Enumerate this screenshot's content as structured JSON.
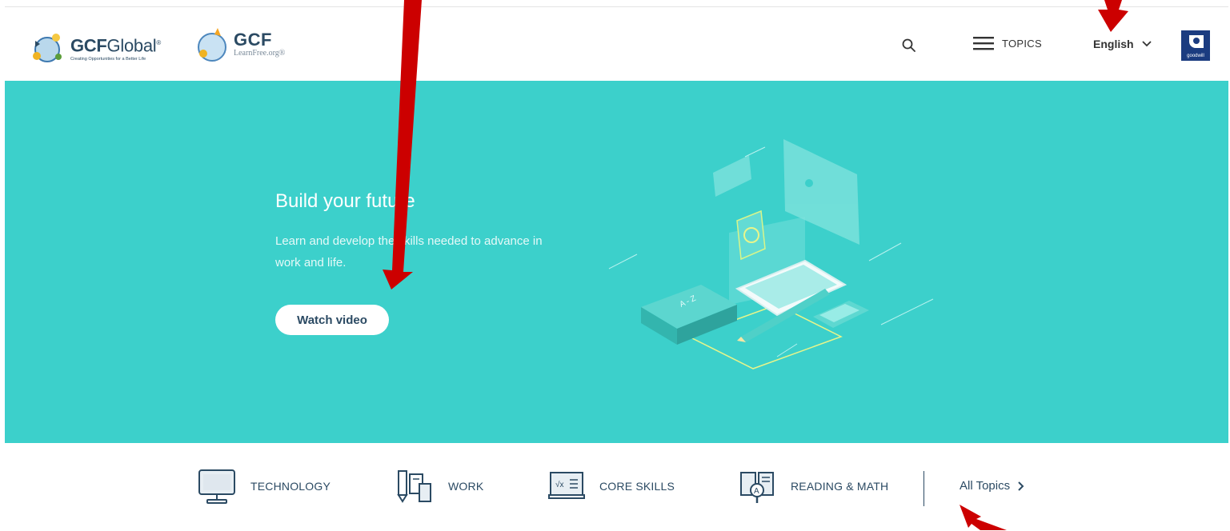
{
  "header": {
    "logo_primary_bold": "GCF",
    "logo_primary_rest": "Global",
    "logo_primary_mark": "®",
    "logo_primary_tagline": "Creating Opportunities for a Better Life",
    "logo_secondary_title": "GCF",
    "logo_secondary_sub": "LearnFree.org®",
    "topics_label": "TOPICS",
    "language_label": "English",
    "partner_logo_text": "goodwill"
  },
  "hero": {
    "title": "Build your future",
    "text": "Learn and develop the skills needed to advance in work and life.",
    "watch_label": "Watch video",
    "illustration_letters": "A - Z"
  },
  "topics": [
    {
      "label": "TECHNOLOGY",
      "icon": "monitor-icon"
    },
    {
      "label": "WORK",
      "icon": "work-tools-icon"
    },
    {
      "label": "CORE SKILLS",
      "icon": "core-skills-icon"
    },
    {
      "label": "READING & MATH",
      "icon": "reading-book-icon"
    }
  ],
  "all_topics_label": "All Topics",
  "colors": {
    "hero_bg": "#3cd0cb",
    "brand_navy": "#2b4a63",
    "annotation_red": "#cc0000",
    "partner_blue": "#1b3c80"
  }
}
